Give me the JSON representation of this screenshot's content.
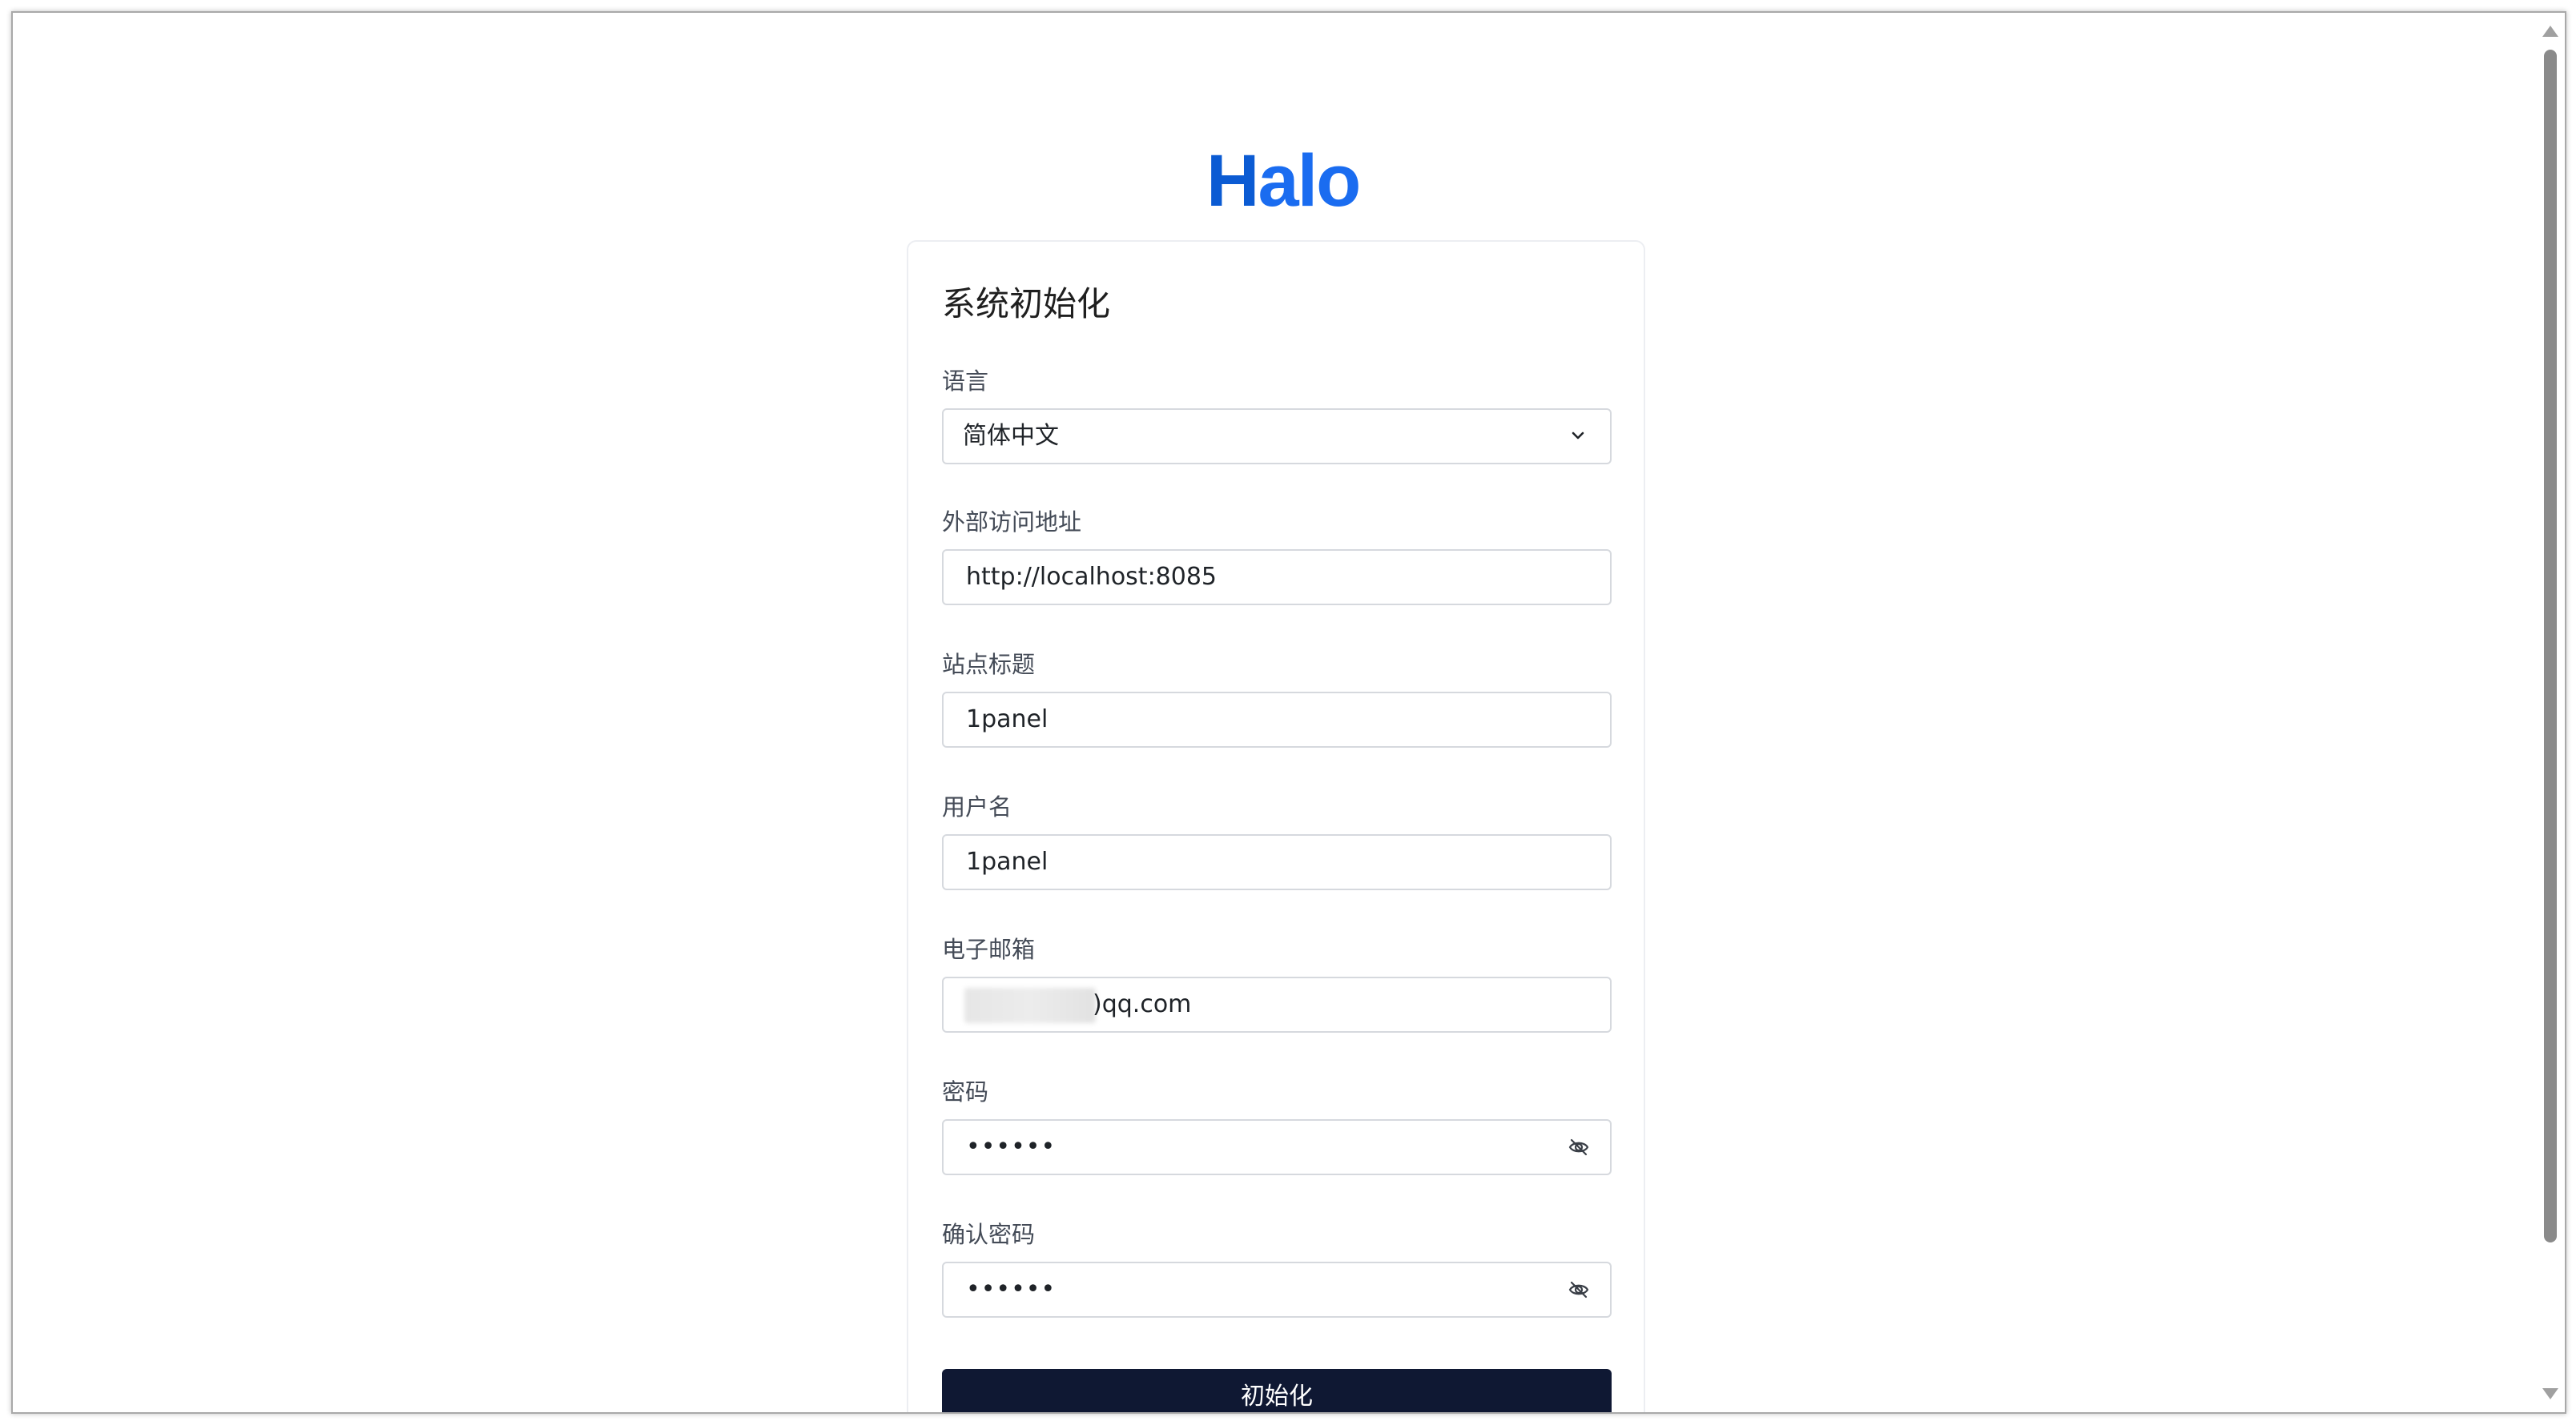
{
  "logo": {
    "text_h": "H",
    "text_rest": "alo"
  },
  "form": {
    "title": "系统初始化",
    "language": {
      "label": "语言",
      "value": "简体中文"
    },
    "external_url": {
      "label": "外部访问地址",
      "value": "http://localhost:8085"
    },
    "site_title": {
      "label": "站点标题",
      "value": "1panel"
    },
    "username": {
      "label": "用户名",
      "value": "1panel"
    },
    "email": {
      "label": "电子邮箱",
      "value_visible": ")qq.com"
    },
    "password": {
      "label": "密码",
      "value": "••••••"
    },
    "confirm_password": {
      "label": "确认密码",
      "value": "••••••"
    },
    "submit_label": "初始化"
  },
  "colors": {
    "logo": "#1a6cf0",
    "button_bg": "#0f1833",
    "border": "#d6d9de"
  },
  "icons": {
    "select": "chevron-down-icon",
    "password_toggle": "eye-off-icon"
  }
}
